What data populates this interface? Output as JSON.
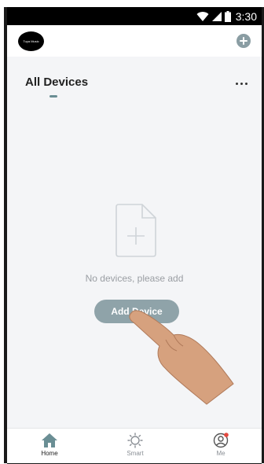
{
  "status_bar": {
    "time": "3:30",
    "icons": [
      "wifi-icon",
      "signal-icon",
      "battery-icon"
    ]
  },
  "header": {
    "logo_text": "Tuya Music",
    "add_icon": "plus-circle-icon"
  },
  "section": {
    "title": "All Devices",
    "more_icon": "more-dots-icon"
  },
  "empty_state": {
    "icon": "document-plus-icon",
    "message": "No devices, please add",
    "button_label": "Add Device"
  },
  "bottom_nav": {
    "items": [
      {
        "label": "Home",
        "icon": "home-icon",
        "active": true
      },
      {
        "label": "Smart",
        "icon": "sun-icon",
        "active": false
      },
      {
        "label": "Me",
        "icon": "profile-icon",
        "active": false,
        "badge": true
      }
    ]
  },
  "colors": {
    "accent": "#8fa3a9",
    "nav_active": "#6a8e94",
    "badge": "#e5493f",
    "background": "#f4f5f7"
  }
}
